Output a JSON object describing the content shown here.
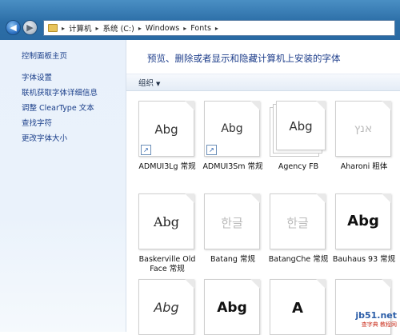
{
  "address": {
    "crumbs": [
      "计算机",
      "系统 (C:)",
      "Windows",
      "Fonts"
    ]
  },
  "sidebar": {
    "home": "控制面板主页",
    "links": [
      "字体设置",
      "联机获取字体详细信息",
      "调整 ClearType 文本",
      "查找字符",
      "更改字体大小"
    ]
  },
  "main": {
    "heading": "预览、删除或者显示和隐藏计算机上安装的字体",
    "organize": "组织",
    "fonts": [
      {
        "sample": "Abg",
        "name": "ADMUI3Lg 常规"
      },
      {
        "sample": "Abg",
        "name": "ADMUI3Sm 常规"
      },
      {
        "sample": "Abg",
        "name": "Agency FB"
      },
      {
        "sample": "אנץ",
        "name": "Aharoni 粗体"
      },
      {
        "sample": "Abg",
        "name": "Baskerville Old Face 常规"
      },
      {
        "sample": "한글",
        "name": "Batang 常规"
      },
      {
        "sample": "한글",
        "name": "BatangChe 常规"
      },
      {
        "sample": "Abg",
        "name": "Bauhaus 93 常规"
      },
      {
        "sample": "Abg",
        "name": ""
      },
      {
        "sample": "Abg",
        "name": ""
      },
      {
        "sample": "A",
        "name": ""
      },
      {
        "sample": "",
        "name": ""
      }
    ]
  },
  "watermark": {
    "line1": "jb51.net",
    "line2": "查字典 教程网"
  }
}
